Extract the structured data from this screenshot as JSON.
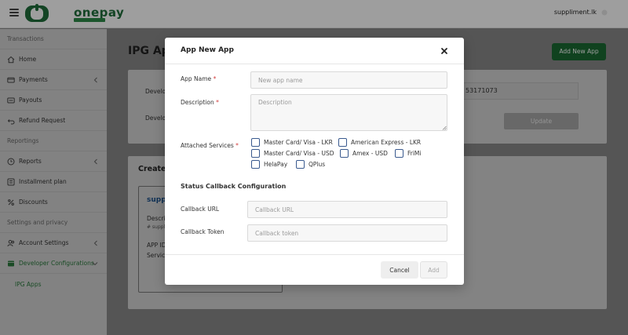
{
  "topbar": {
    "logo_text": "onepay",
    "user_name": "suppliment.lk"
  },
  "sidebar": {
    "sections": [
      {
        "heading": "Transactions",
        "items": [
          {
            "label": "Home",
            "icon": "home-icon"
          },
          {
            "label": "Payments",
            "icon": "card-icon",
            "has_chevron": true
          },
          {
            "label": "Payouts",
            "icon": "payout-icon"
          },
          {
            "label": "Refund Request",
            "icon": "refund-icon"
          }
        ]
      },
      {
        "heading": "Reportings",
        "items": [
          {
            "label": "Reports",
            "icon": "clock-icon",
            "has_chevron": true
          },
          {
            "label": "Installment plan",
            "icon": "list-icon"
          },
          {
            "label": "Discounts",
            "icon": "percent-icon"
          }
        ]
      },
      {
        "heading": "Settings and privacy",
        "items": [
          {
            "label": "Account Settings",
            "icon": "users-icon",
            "has_chevron": true
          },
          {
            "label": "Developer Configurations",
            "icon": "dev-icon",
            "has_chevron": true
          }
        ]
      }
    ],
    "sub_item": "IPG Apps"
  },
  "main": {
    "title": "IPG Apps",
    "add_button": "Add New App",
    "developer_label_1": "Developer",
    "developer_label_2": "Developer",
    "developer_id_value": "53171073",
    "update_button": "Update",
    "created_title": "Created",
    "app_card": {
      "name": "suppliment",
      "description_label": "Description",
      "description_value": "# suppliment",
      "app_id_label": "APP ID",
      "services_label": "Services"
    }
  },
  "modal": {
    "title": "App New App",
    "app_name_label": "App Name",
    "app_name_placeholder": "New app name",
    "description_label": "Description",
    "description_placeholder": "Description",
    "attached_services_label": "Attached Services",
    "required_mark": "*",
    "services": [
      "Master Card/ Visa - LKR",
      "American Express - LKR",
      "Master Card/ Visa - USD",
      "Amex - USD",
      "FriMi",
      "HelaPay",
      "QPlus"
    ],
    "callback_section_title": "Status Callback Configuration",
    "callback_url_label": "Callback URL",
    "callback_url_placeholder": "Callback URL",
    "callback_token_label": "Callback Token",
    "callback_token_placeholder": "Callback token",
    "cancel_button": "Cancel",
    "add_button": "Add"
  },
  "colors": {
    "brand_green": "#1b6b33",
    "required_red": "#d23b3b",
    "checkbox_border": "#3a5a8f"
  }
}
